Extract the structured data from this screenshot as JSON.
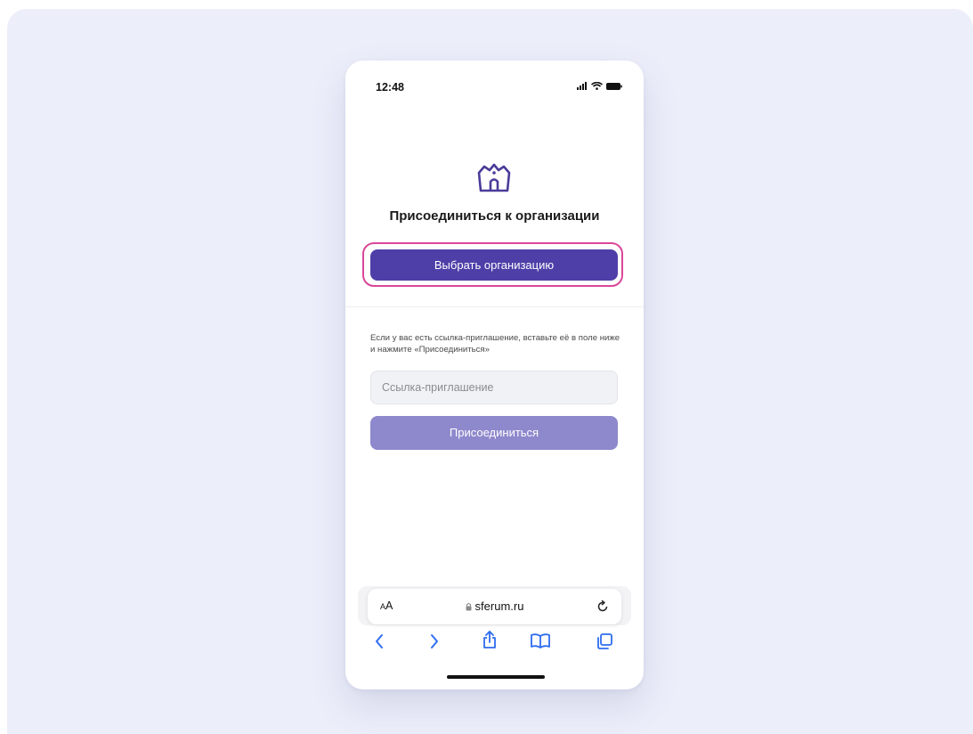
{
  "status_bar": {
    "time": "12:48"
  },
  "page": {
    "title": "Присоединиться к организации",
    "select_org_button": "Выбрать организацию",
    "invite_hint": "Если у вас есть ссылка-приглашение, вставьте её в поле ниже и нажмите «Присоединиться»",
    "invite_input_placeholder": "Ссылка-приглашение",
    "join_button": "Присоединиться"
  },
  "browser": {
    "text_size_label_small": "A",
    "text_size_label_large": "A",
    "url": "sferum.ru",
    "toolbar_icons": [
      "back-icon",
      "forward-icon",
      "share-icon",
      "bookmarks-icon",
      "tabs-icon"
    ]
  },
  "colors": {
    "stage_background": "#eceefa",
    "primary_button": "#4e3fa8",
    "join_button": "#8e88cc",
    "highlight_ring": "#d9479a",
    "browser_toolbar_icons": "#2e6cf0"
  }
}
